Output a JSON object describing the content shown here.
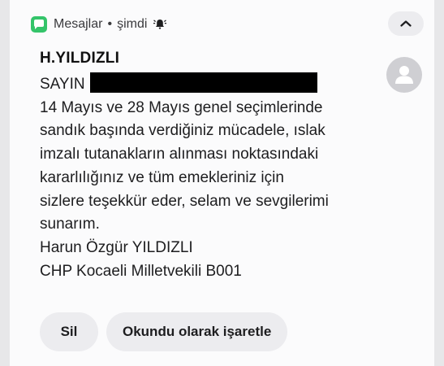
{
  "notification": {
    "app_name": "Mesajlar",
    "separator": "•",
    "time": "şimdi",
    "sender": "H.YILDIZLI",
    "greeting": "SAYIN",
    "message_lines": [
      "14 Mayıs ve 28 Mayıs genel seçimlerinde",
      "sandık başında verdiğiniz mücadele, ıslak",
      "imzalı tutanakların alınması noktasındaki",
      "kararlılığınız ve tüm emekleriniz için",
      "sizlere teşekkür eder, selam ve sevgilerimi",
      "sunarım.",
      "Harun Özgür YILDIZLI",
      "CHP Kocaeli Milletvekili B001"
    ],
    "actions": {
      "delete_label": "Sil",
      "mark_read_label": "Okundu olarak işaretle"
    },
    "icons": {
      "app": "message-app-icon",
      "bell": "bell-ringing-icon",
      "collapse": "chevron-up-icon",
      "avatar": "person-icon"
    },
    "colors": {
      "app_icon": "#34c46a",
      "background": "#e7e7e9",
      "card": "#fbfbfc",
      "button": "#ececef"
    }
  }
}
